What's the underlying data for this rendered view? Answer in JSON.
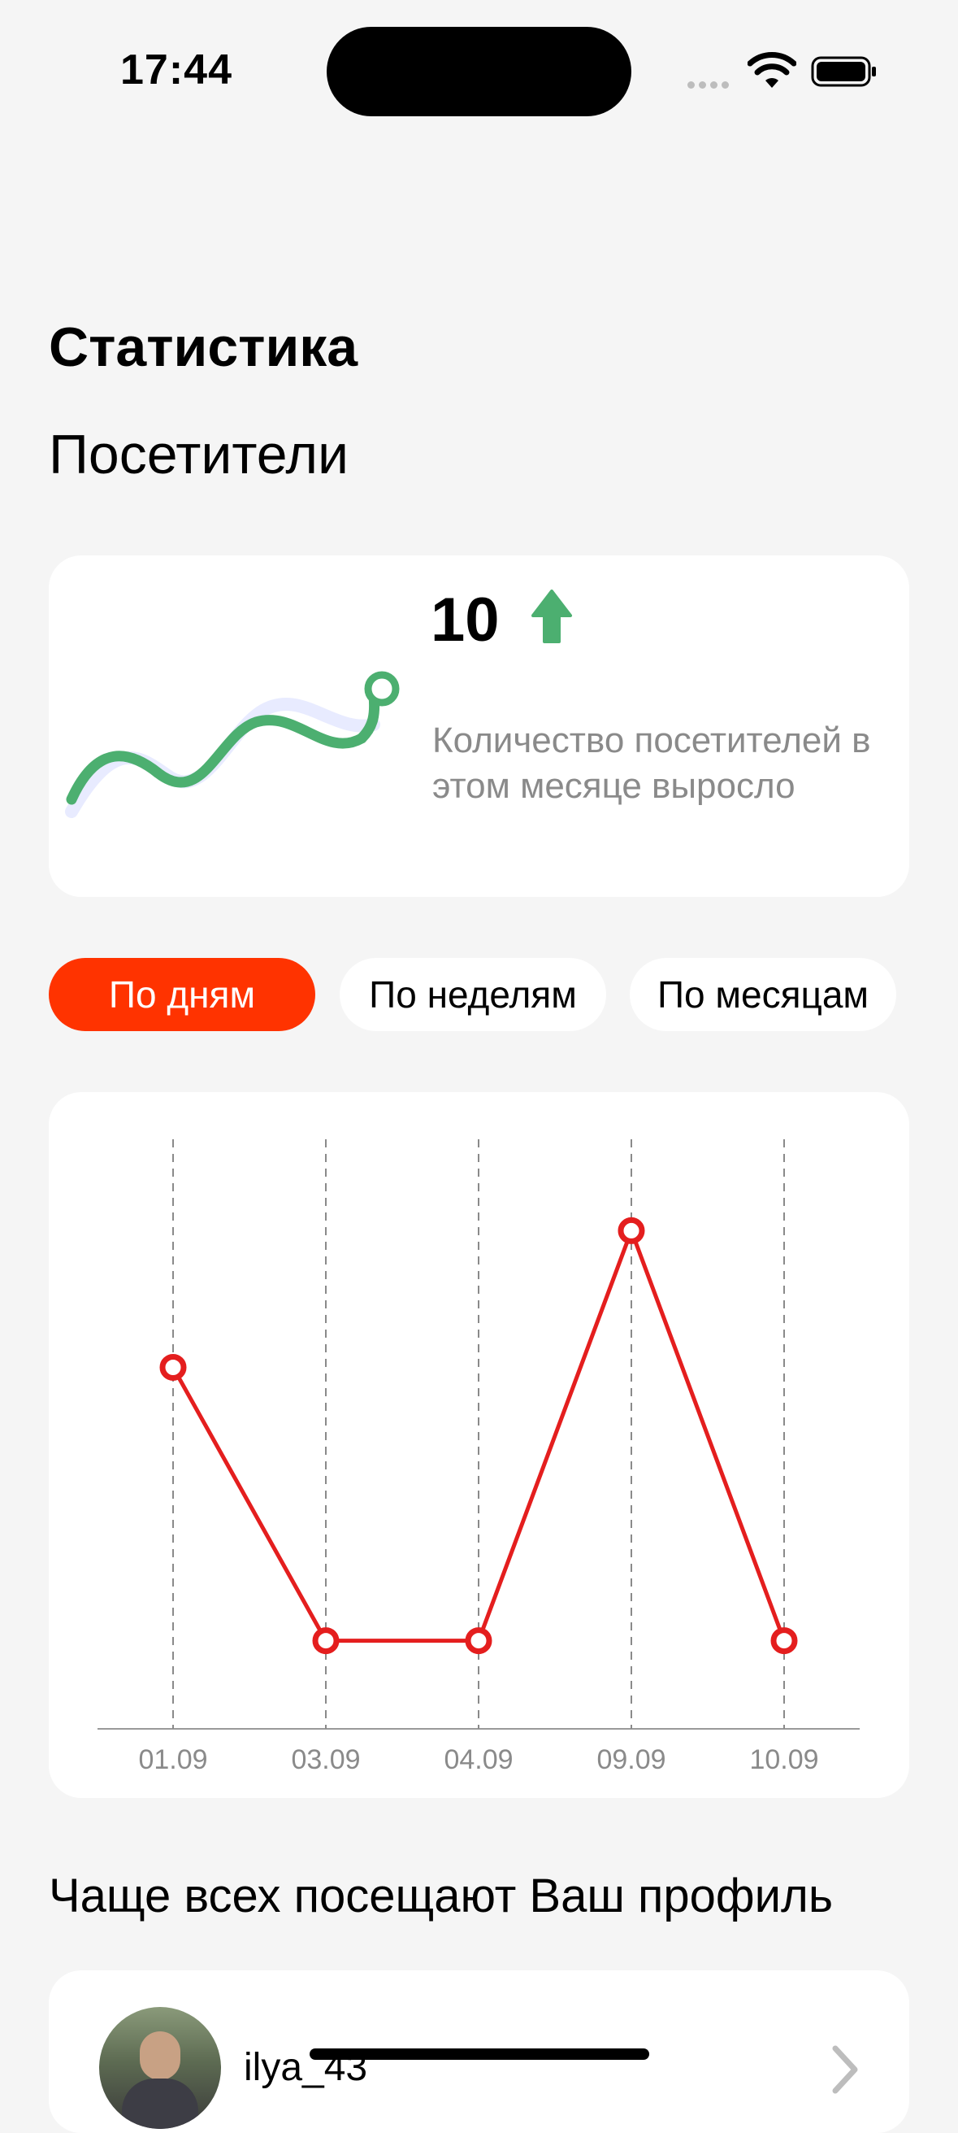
{
  "status_bar": {
    "time": "17:44"
  },
  "page_title": "Статистика",
  "section_title": "Посетители",
  "summary": {
    "value": "10",
    "description": "Количество посетителей в этом месяце выросло",
    "trend": "up",
    "trend_color": "#4caf70"
  },
  "filters": [
    {
      "label": "По дням",
      "active": true
    },
    {
      "label": "По неделям",
      "active": false
    },
    {
      "label": "По месяцам",
      "active": false
    }
  ],
  "chart_data": {
    "type": "line",
    "categories": [
      "01.09",
      "03.09",
      "04.09",
      "09.09",
      "10.09"
    ],
    "series": [
      {
        "values": [
          3,
          1,
          1,
          4,
          1
        ]
      }
    ],
    "ylim": [
      0.7,
      4.3
    ],
    "color": "#e41e1e",
    "grid": "vertical dashed"
  },
  "top_visitors_title": "Чаще всех посещают Ваш профиль",
  "visitors": [
    {
      "name": "ilya_43"
    }
  ],
  "colors": {
    "accent": "#ff3300",
    "background": "#f5f5f5"
  }
}
